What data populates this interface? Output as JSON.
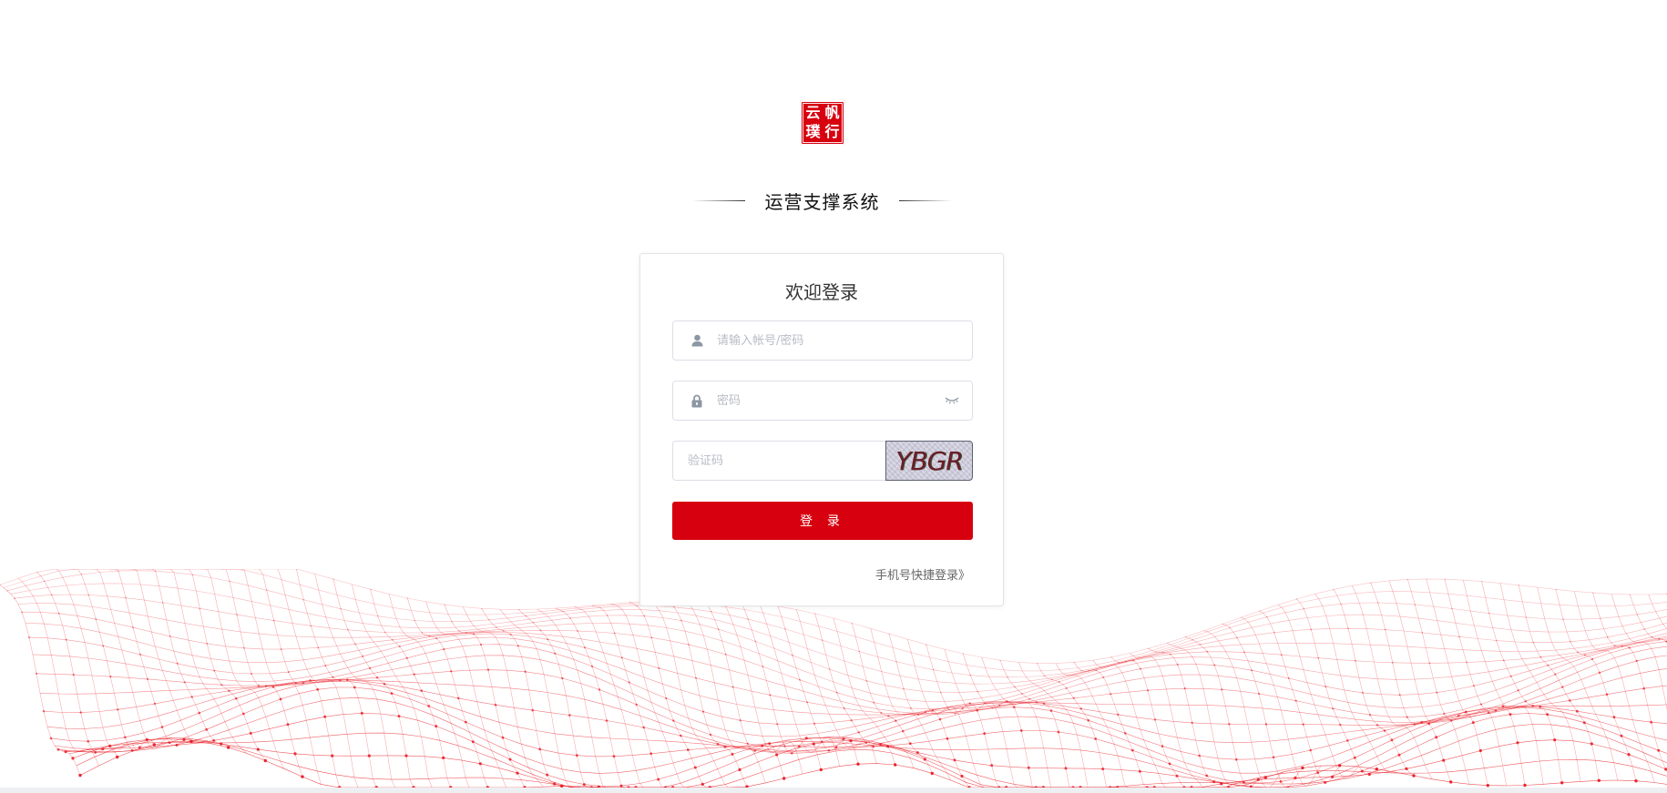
{
  "logo": {
    "chars": [
      "云",
      "帆",
      "璞",
      "行"
    ],
    "color": "#d7000f"
  },
  "system_title": "运营支撑系统",
  "login": {
    "title": "欢迎登录",
    "username_placeholder": "请输入帐号/密码",
    "password_placeholder": "密码",
    "captcha_placeholder": "验证码",
    "captcha_text": "YBGR",
    "submit_label": "登 录",
    "phone_login_link": "手机号快捷登录》"
  },
  "icons": {
    "username": "user-icon",
    "password": "lock-icon",
    "toggle_password": "eye-closed-icon"
  },
  "colors": {
    "accent": "#d7000f",
    "mesh": "#e8141e"
  }
}
